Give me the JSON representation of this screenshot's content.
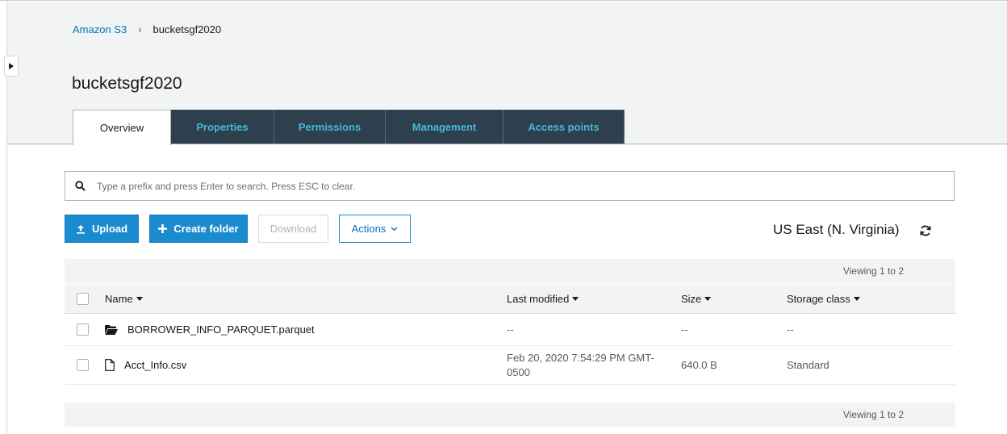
{
  "breadcrumb": {
    "root": "Amazon S3",
    "separator": "›",
    "current": "bucketsgf2020"
  },
  "page_title": "bucketsgf2020",
  "tabs": [
    {
      "label": "Overview",
      "active": true
    },
    {
      "label": "Properties",
      "active": false
    },
    {
      "label": "Permissions",
      "active": false
    },
    {
      "label": "Management",
      "active": false
    },
    {
      "label": "Access points",
      "active": false
    }
  ],
  "search": {
    "placeholder": "Type a prefix and press Enter to search. Press ESC to clear.",
    "value": ""
  },
  "toolbar": {
    "upload_label": "Upload",
    "create_folder_label": "Create folder",
    "download_label": "Download",
    "actions_label": "Actions"
  },
  "region": "US East (N. Virginia)",
  "table": {
    "viewing_top": "Viewing 1 to 2",
    "viewing_bottom": "Viewing 1 to 2",
    "columns": {
      "name": "Name",
      "last_modified": "Last modified",
      "size": "Size",
      "storage_class": "Storage class"
    },
    "rows": [
      {
        "type": "folder",
        "name": "BORROWER_INFO_PARQUET.parquet",
        "last_modified": "--",
        "size": "--",
        "storage_class": "--"
      },
      {
        "type": "file",
        "name": "Acct_Info.csv",
        "last_modified": "Feb 20, 2020 7:54:29 PM GMT-0500",
        "size": "640.0 B",
        "storage_class": "Standard"
      }
    ]
  },
  "colors": {
    "primary_button": "#1a8bce",
    "tab_dark": "#2e3f4e",
    "tab_text": "#44b9d6",
    "link": "#0073bb",
    "header_band": "#f2f3f3"
  },
  "icons": {
    "search": "search-icon",
    "upload": "upload-icon",
    "create_folder": "plus-icon",
    "actions_dropdown": "chevron-down-icon",
    "refresh": "refresh-icon",
    "folder": "folder-icon",
    "file": "file-icon",
    "collapse": "caret-right-icon"
  }
}
